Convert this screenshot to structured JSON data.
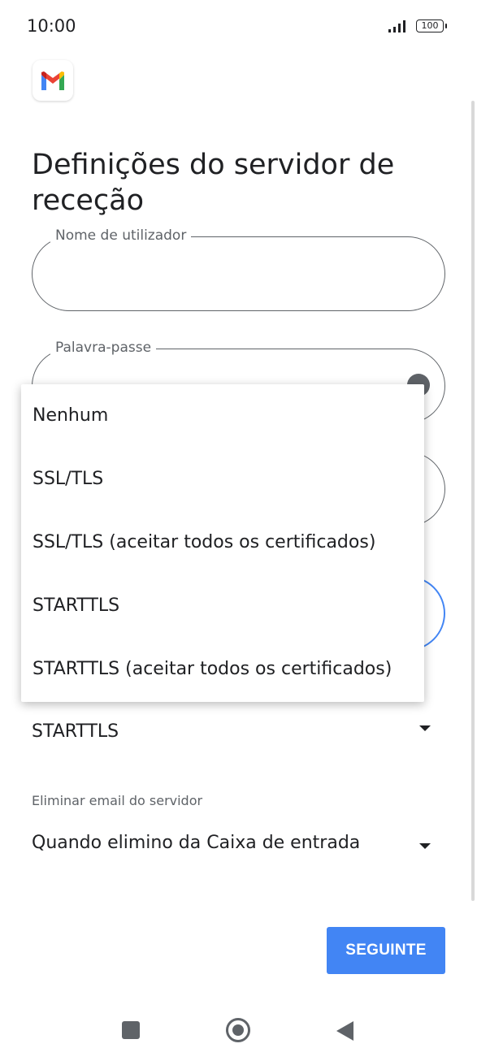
{
  "status_bar": {
    "time": "10:00",
    "battery": "100"
  },
  "page": {
    "title": "Definições do servidor de receção"
  },
  "fields": {
    "username": {
      "label": "Nome de utilizador",
      "value": ""
    },
    "password": {
      "label": "Palavra-passe",
      "value": ""
    }
  },
  "security": {
    "selected": "STARTTLS"
  },
  "delete_setting": {
    "label": "Eliminar email do servidor",
    "value": "Quando elimino da Caixa de entrada"
  },
  "menu": {
    "items": [
      "Nenhum",
      "SSL/TLS",
      "SSL/TLS (aceitar todos os certificados)",
      "STARTTLS",
      "STARTTLS (aceitar todos os certificados)"
    ]
  },
  "buttons": {
    "next": "SEGUINTE"
  },
  "colors": {
    "accent": "#4285f4",
    "text": "#202124",
    "secondary": "#5f6368"
  },
  "icons": [
    "gmail-logo-icon",
    "signal-icon",
    "battery-icon",
    "eye-icon",
    "chevron-down-icon",
    "recents-icon",
    "home-icon",
    "back-icon"
  ]
}
